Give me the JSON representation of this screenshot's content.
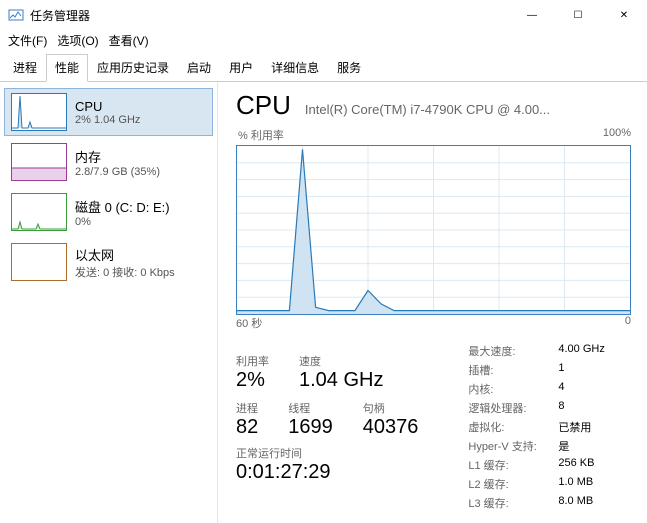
{
  "window": {
    "title": "任务管理器",
    "min": "—",
    "max": "☐",
    "close": "✕"
  },
  "menu": {
    "file": "文件(F)",
    "options": "选项(O)",
    "view": "查看(V)"
  },
  "tabs": [
    "进程",
    "性能",
    "应用历史记录",
    "启动",
    "用户",
    "详细信息",
    "服务"
  ],
  "active_tab": 1,
  "sidebar": [
    {
      "title": "CPU",
      "sub": "2% 1.04 GHz",
      "color": "#2a7ab8",
      "kind": "cpu"
    },
    {
      "title": "内存",
      "sub": "2.8/7.9 GB (35%)",
      "color": "#9b3c9b",
      "kind": "mem"
    },
    {
      "title": "磁盘 0 (C: D: E:)",
      "sub": "0%",
      "color": "#3a9b3a",
      "kind": "disk"
    },
    {
      "title": "以太网",
      "sub": "发送: 0 接收: 0 Kbps",
      "color": "#b06a2a",
      "kind": "net"
    }
  ],
  "main": {
    "heading": "CPU",
    "desc": "Intel(R) Core(TM) i7-4790K CPU @ 4.00...",
    "util_label": "% 利用率",
    "pct100": "100%",
    "x_left": "60 秒",
    "x_right": "0",
    "stats1": [
      {
        "label": "利用率",
        "value": "2%"
      },
      {
        "label": "速度",
        "value": "1.04 GHz"
      }
    ],
    "stats2": [
      {
        "label": "进程",
        "value": "82"
      },
      {
        "label": "线程",
        "value": "1699"
      },
      {
        "label": "句柄",
        "value": "40376"
      }
    ],
    "uptime_label": "正常运行时间",
    "uptime_value": "0:01:27:29",
    "kv": [
      {
        "k": "最大速度:",
        "v": "4.00 GHz"
      },
      {
        "k": "插槽:",
        "v": "1"
      },
      {
        "k": "内核:",
        "v": "4"
      },
      {
        "k": "逻辑处理器:",
        "v": "8"
      },
      {
        "k": "虚拟化:",
        "v": "已禁用"
      },
      {
        "k": "Hyper-V 支持:",
        "v": "是"
      },
      {
        "k": "L1 缓存:",
        "v": "256 KB"
      },
      {
        "k": "L2 缓存:",
        "v": "1.0 MB"
      },
      {
        "k": "L3 缓存:",
        "v": "8.0 MB"
      }
    ]
  },
  "chart_data": {
    "type": "line",
    "title": "% 利用率",
    "xlabel": "60 秒 → 0",
    "ylabel": "% 利用率",
    "ylim": [
      0,
      100
    ],
    "xlim": [
      0,
      60
    ],
    "x": [
      0,
      2,
      4,
      6,
      8,
      10,
      12,
      14,
      16,
      18,
      20,
      22,
      24,
      26,
      28,
      30,
      32,
      34,
      36,
      38,
      40,
      42,
      44,
      46,
      48,
      50,
      52,
      54,
      56,
      58,
      60
    ],
    "values": [
      2,
      2,
      2,
      2,
      2,
      98,
      4,
      2,
      2,
      2,
      14,
      6,
      2,
      2,
      2,
      2,
      2,
      2,
      2,
      2,
      2,
      2,
      2,
      2,
      2,
      2,
      2,
      2,
      2,
      2,
      2
    ]
  }
}
